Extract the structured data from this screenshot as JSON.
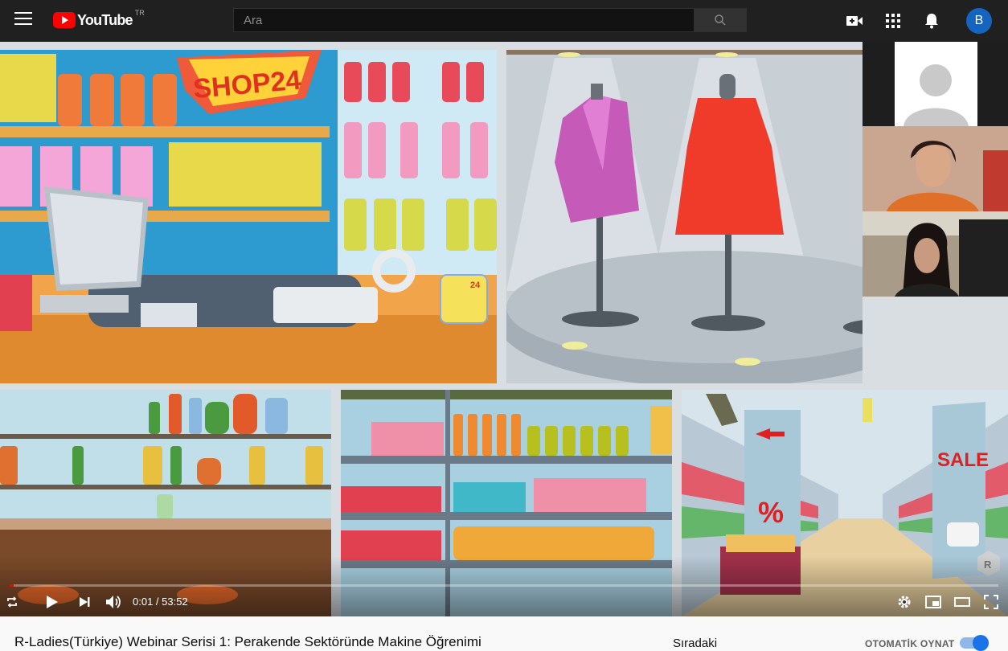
{
  "masthead": {
    "logo_text": "YouTube",
    "country_code": "TR",
    "search_placeholder": "Ara",
    "avatar_letter": "B",
    "icons": [
      "menu-icon",
      "search-icon",
      "create-video-icon",
      "apps-icon",
      "notifications-icon"
    ]
  },
  "video": {
    "scene_signs": {
      "shop_sign": "SHOP24",
      "jar_label": "24",
      "sale_sign": "SALE",
      "percent_sign": "%"
    },
    "watermark": "R",
    "progress": 0.0003
  },
  "player_controls": {
    "time_display": "0:01 / 53:52",
    "current_time": "0:01",
    "duration": "53:52",
    "icons": [
      "loop-icon",
      "play-icon",
      "next-icon",
      "volume-icon",
      "settings-icon",
      "miniplayer-icon",
      "theater-icon",
      "fullscreen-icon"
    ]
  },
  "below_video": {
    "title": "R-Ladies(Türkiye) Webinar Serisi 1: Perakende Sektöründe Makine Öğrenimi",
    "up_next": "Sıradaki",
    "autoplay_label": "OTOMATİK OYNAT",
    "autoplay_on": true
  },
  "colors": {
    "masthead_bg": "#202020",
    "brand_red": "#ff0000",
    "avatar_blue": "#1565c0",
    "toggle_blue": "#1a73e8"
  }
}
